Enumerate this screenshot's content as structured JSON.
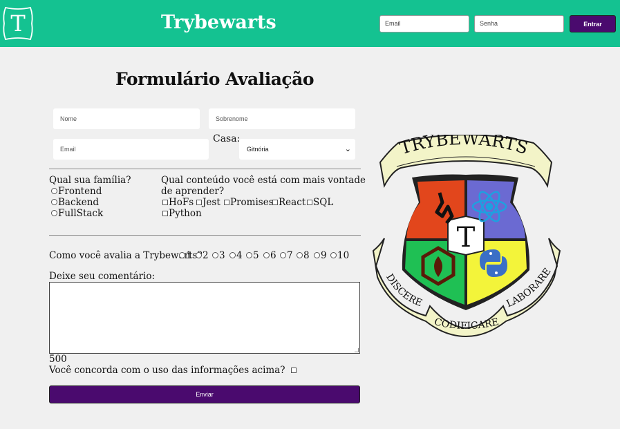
{
  "header": {
    "logo_letter": "T",
    "title": "Trybewarts",
    "email_placeholder": "Email",
    "password_placeholder": "Senha",
    "login_button": "Entrar"
  },
  "form": {
    "title": "Formulário Avaliação",
    "nome_placeholder": "Nome",
    "sobrenome_placeholder": "Sobrenome",
    "email_placeholder": "Email",
    "casa_label": "Casa:",
    "casa_selected": "Gitnória",
    "familia_question": "Qual sua família?",
    "familia_options": [
      "Frontend",
      "Backend",
      "FullStack"
    ],
    "conteudo_question_line1": "Qual conteúdo você está com mais vontade",
    "conteudo_question_line2": "de aprender?",
    "conteudo_options": [
      "HoFs",
      "Jest",
      "Promises",
      "React",
      "SQL",
      "Python"
    ],
    "rating_question": "Como você avalia a Trybewarts?",
    "rating_options": [
      "1",
      "2",
      "3",
      "4",
      "5",
      "6",
      "7",
      "8",
      "9",
      "10"
    ],
    "comment_label": "Deixe seu comentário:",
    "char_counter": "500",
    "agreement_label": "Você concorda com o uso das informações acima?",
    "submit_button": "Enviar"
  },
  "crest": {
    "banner_top": "TRYBEWARTS",
    "center_letter": "T",
    "motto_left": "DISCERE",
    "motto_bottom": "CODIFICARE",
    "motto_right": "LABORARE"
  },
  "colors": {
    "header_bg": "#14c291",
    "button_bg": "#4a0a6e",
    "page_bg": "#f0f0f0"
  },
  "icons": [
    "trybewarts-logo-icon",
    "text-cursor-icon",
    "chevron-down-icon",
    "trybewarts-crest-icon",
    "react-icon",
    "python-icon"
  ]
}
